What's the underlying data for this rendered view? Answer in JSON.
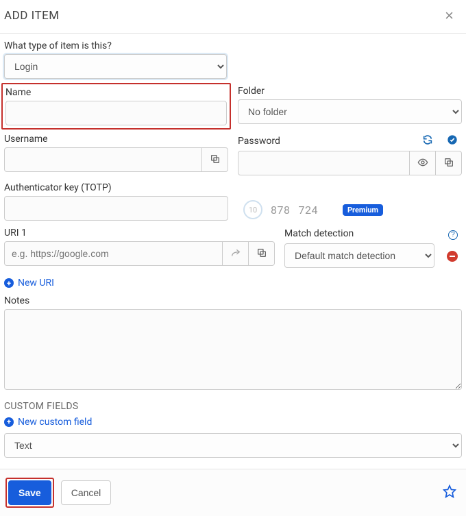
{
  "header": {
    "title": "ADD ITEM",
    "close": "×"
  },
  "type": {
    "label": "What type of item is this?",
    "selected": "Login"
  },
  "name": {
    "label": "Name",
    "value": ""
  },
  "folder": {
    "label": "Folder",
    "selected": "No folder"
  },
  "username": {
    "label": "Username",
    "value": ""
  },
  "password": {
    "label": "Password",
    "value": ""
  },
  "totp": {
    "label": "Authenticator key (TOTP)",
    "value": "",
    "countdown": "10",
    "code_a": "878",
    "code_b": "724",
    "premium": "Premium"
  },
  "uri": {
    "label": "URI 1",
    "placeholder": "e.g. https://google.com",
    "value": "",
    "new_uri": "New URI",
    "match_label": "Match detection",
    "match_selected": "Default match detection"
  },
  "notes": {
    "label": "Notes",
    "value": ""
  },
  "custom": {
    "label": "CUSTOM FIELDS",
    "new_field": "New custom field",
    "type_selected": "Text"
  },
  "footer": {
    "save": "Save",
    "cancel": "Cancel"
  }
}
